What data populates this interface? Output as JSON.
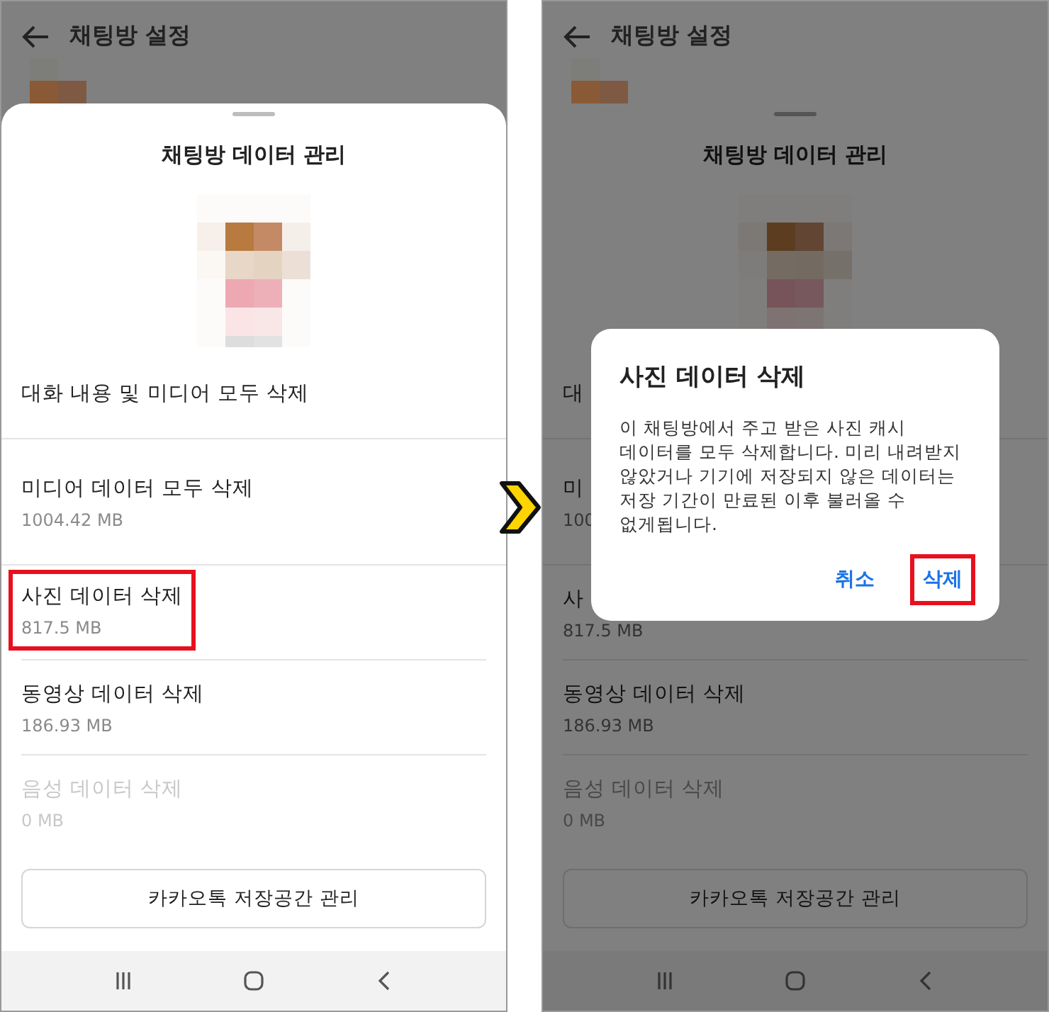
{
  "phones": [
    {
      "dimmed": false,
      "header": {
        "title": "채팅방 설정"
      },
      "sheet": {
        "title": "채팅방 데이터 관리",
        "rows": [
          {
            "label": "대화 내용 및 미디어 모두 삭제",
            "disabled": false,
            "highlighted": false
          },
          {
            "label": "미디어 데이터 모두 삭제",
            "size": "1004.42 MB",
            "disabled": false,
            "highlighted": false
          },
          {
            "label": "사진 데이터 삭제",
            "size": "817.5 MB",
            "disabled": false,
            "highlighted": true
          },
          {
            "label": "동영상 데이터 삭제",
            "size": "186.93 MB",
            "disabled": false,
            "highlighted": false
          },
          {
            "label": "음성 데이터 삭제",
            "size": "0 MB",
            "disabled": true,
            "highlighted": false
          }
        ],
        "button": "카카오톡 저장공간 관리"
      }
    },
    {
      "dimmed": true,
      "header": {
        "title": "채팅방 설정"
      },
      "sheet": {
        "title": "채팅방 데이터 관리",
        "rows": [
          {
            "label": "대",
            "disabled": false,
            "highlighted": false
          },
          {
            "label": "미",
            "size": "100",
            "disabled": false,
            "highlighted": false
          },
          {
            "label": "사",
            "size": "817.5 MB",
            "disabled": false,
            "highlighted": false
          },
          {
            "label": "동영상 데이터 삭제",
            "size": "186.93 MB",
            "disabled": false,
            "highlighted": false
          },
          {
            "label": "음성 데이터 삭제",
            "size": "0 MB",
            "disabled": true,
            "highlighted": false
          }
        ],
        "button": "카카오톡 저장공간 관리"
      },
      "dialog": {
        "title": "사진 데이터 삭제",
        "message": "이 채팅방에서 주고 받은 사진 캐시 데이터를 모두 삭제합니다. 미리 내려받지 않았거나 기기에 저장되지 않은 데이터는 저장 기간이 만료된 이후 불러올 수 없게됩니다.",
        "buttons": [
          {
            "label": "취소",
            "highlighted": false
          },
          {
            "label": "삭제",
            "highlighted": true
          }
        ]
      }
    }
  ]
}
